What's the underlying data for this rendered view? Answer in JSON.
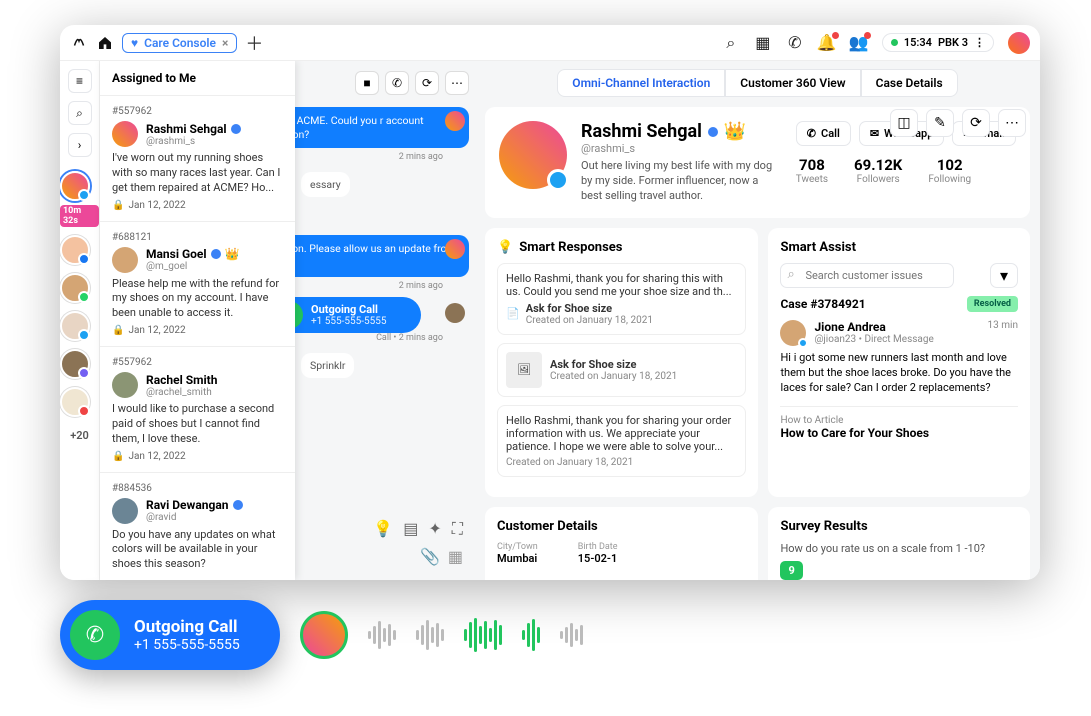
{
  "topbar": {
    "tab_label": "Care Console",
    "time": "15:34",
    "station": "PBK 3"
  },
  "leftrail": {
    "timer": "10m 32s",
    "more": "+20"
  },
  "assigned": {
    "title": "Assigned to Me",
    "cards": [
      {
        "id": "#557962",
        "name": "Rashmi Sehgal",
        "handle": "@rashmi_s",
        "text": "I've worn out my running shoes with so many races last year. Can I get them repaired at ACME? Ho...",
        "date": "Jan 12, 2022"
      },
      {
        "id": "#688121",
        "name": "Mansi Goel",
        "handle": "@m_goel",
        "text": "Please help me with the refund for my shoes on my account. I have been unable to access it.",
        "date": "Jan 12, 2022"
      },
      {
        "id": "#557962",
        "name": "Rachel Smith",
        "handle": "@rachel_smith",
        "text": "I would like to purchase a second paid of shoes but I cannot find them, I love these.",
        "date": "Jan 12, 2022"
      },
      {
        "id": "#884536",
        "name": "Ravi Dewangan",
        "handle": "@ravid",
        "text": "Do you have any updates on what colors will be available in your shoes this season?",
        "date": ""
      }
    ]
  },
  "chat": {
    "msg1": "ing out to ACME. Could you r account information?",
    "time1": "2 mins ago",
    "in1": "essary",
    "msg2": "onfirmation. Please allow us an update from the team.",
    "time2": "2 mins ago",
    "call_title": "Outgoing Call",
    "call_number": "+1 555-555-5555",
    "call_meta": "Call • 2 mins ago",
    "in2": "Sprinklr"
  },
  "tabs": {
    "t1": "Omni-Channel Interaction",
    "t2": "Customer 360 View",
    "t3": "Case Details"
  },
  "profile": {
    "name": "Rashmi Sehgal",
    "handle": "@rashmi_s",
    "bio": "Out here living my best life with my dog by my side. Former influencer, now a best selling travel author.",
    "btn_call": "Call",
    "btn_wa": "Whatsapp",
    "btn_email": "Email",
    "stats": {
      "tweets_v": "708",
      "tweets_l": "Tweets",
      "foll_v": "69.12K",
      "foll_l": "Followers",
      "flw_v": "102",
      "flw_l": "Following"
    }
  },
  "smart_responses": {
    "title": "Smart Responses",
    "r1_text": "Hello Rashmi, thank you for sharing this with us. Could you send me your shoe size and th...",
    "r1_title": "Ask for Shoe size",
    "r1_sub": "Created on January 18, 2021",
    "r2_title": "Ask for Shoe size",
    "r2_sub": "Created on January 18, 2021",
    "r3_text": "Hello Rashmi, thank you for sharing your order information with us. We appreciate your patience. I hope we were able to solve your...",
    "r3_sub": "Created on January 18, 2021"
  },
  "smart_assist": {
    "title": "Smart Assist",
    "search_ph": "Search customer issues",
    "case": "Case #3784921",
    "resolved": "Resolved",
    "poster_name": "Jione Andrea",
    "poster_meta": "@jioan23 • Direct Message",
    "time": "13 min",
    "text": "Hi i got some new runners last month and love them but the shoe laces broke. Do you have the laces for sale? Can I order 2 replacements?",
    "howto_lbl": "How to Article",
    "howto_ttl": "How to Care for Your Shoes"
  },
  "cust": {
    "title": "Customer Details",
    "city_lbl": "City/Town",
    "city_val": "Mumbai",
    "birth_lbl": "Birth Date",
    "birth_val": "15-02-1"
  },
  "survey": {
    "title": "Survey Results",
    "q": "How do you rate us on a scale from 1 -10?",
    "score": "9"
  },
  "floating_call": {
    "title": "Outgoing Call",
    "number": "+1 555-555-5555"
  }
}
